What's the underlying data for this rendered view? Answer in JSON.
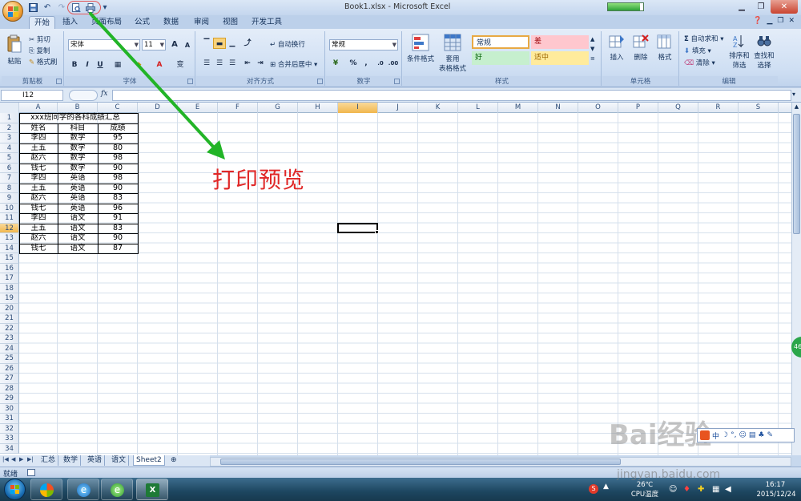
{
  "window": {
    "title": "Book1.xlsx - Microsoft Excel",
    "progress_fraction": 0.9
  },
  "qat": {
    "undo": "↶",
    "redo": "↷",
    "more": "▾"
  },
  "tabs": [
    {
      "label": "开始",
      "active": true
    },
    {
      "label": "插入"
    },
    {
      "label": "页面布局"
    },
    {
      "label": "公式"
    },
    {
      "label": "数据"
    },
    {
      "label": "审阅"
    },
    {
      "label": "视图"
    },
    {
      "label": "开发工具"
    }
  ],
  "ribbon": {
    "clipboard": {
      "paste": "粘贴",
      "cut": "剪切",
      "copy": "复制",
      "format_painter": "格式刷",
      "label": "剪贴板"
    },
    "font": {
      "name": "宋体",
      "size": "11",
      "bold": "B",
      "italic": "I",
      "underline": "U",
      "label": "字体",
      "grow": "A",
      "shrink": "A",
      "phonetic": "变"
    },
    "alignment": {
      "wrap": "自动换行",
      "merge": "合并后居中",
      "label": "对齐方式"
    },
    "number": {
      "format": "常规",
      "percent": "%",
      "comma": ",",
      "label": "数字"
    },
    "styles": {
      "conditional": "条件格式",
      "table_format": "套用",
      "table_format2": "表格格式",
      "normal": "常规",
      "bad": "差",
      "good": "好",
      "neutral": "适中",
      "label": "样式",
      "color_normal": "#ffffff",
      "color_bad": "#ffc7ce",
      "color_good": "#c6efce",
      "color_neutral": "#ffeb9c"
    },
    "cells": {
      "insert": "插入",
      "delete": "删除",
      "format": "格式",
      "label": "单元格"
    },
    "editing": {
      "autosum": "自动求和",
      "fill": "填充",
      "clear": "清除",
      "sort": "排序和",
      "sort2": "筛选",
      "find": "查找和",
      "find2": "选择",
      "label": "编辑"
    }
  },
  "formula_bar": {
    "name_box": "I12",
    "fx": "fx",
    "content": ""
  },
  "columns": [
    "A",
    "B",
    "C",
    "D",
    "E",
    "F",
    "G",
    "H",
    "I",
    "J",
    "K",
    "L",
    "M",
    "N",
    "O",
    "P",
    "Q",
    "R",
    "S"
  ],
  "selected_column": "I",
  "rows": [
    "1",
    "2",
    "3",
    "4",
    "5",
    "6",
    "7",
    "8",
    "9",
    "10",
    "11",
    "12",
    "13",
    "14",
    "15",
    "16",
    "17",
    "18",
    "19",
    "20",
    "21",
    "22",
    "23",
    "24",
    "25",
    "26",
    "27",
    "28",
    "29",
    "30",
    "31",
    "32",
    "33",
    "34"
  ],
  "selected_row": "12",
  "sheet": {
    "title": "xxx班同学的各科成绩汇总",
    "headers": [
      "姓名",
      "科目",
      "成绩"
    ],
    "data": [
      [
        "李四",
        "数学",
        "95"
      ],
      [
        "王五",
        "数学",
        "80"
      ],
      [
        "赵六",
        "数学",
        "98"
      ],
      [
        "钱七",
        "数学",
        "90"
      ],
      [
        "李四",
        "英语",
        "98"
      ],
      [
        "王五",
        "英语",
        "90"
      ],
      [
        "赵六",
        "英语",
        "83"
      ],
      [
        "钱七",
        "英语",
        "96"
      ],
      [
        "李四",
        "语文",
        "91"
      ],
      [
        "王五",
        "语文",
        "83"
      ],
      [
        "赵六",
        "语文",
        "90"
      ],
      [
        "钱七",
        "语文",
        "87"
      ]
    ]
  },
  "sheet_tabs": [
    {
      "label": "汇总"
    },
    {
      "label": "数学"
    },
    {
      "label": "英语"
    },
    {
      "label": "语文"
    },
    {
      "label": "Sheet2",
      "active": true
    }
  ],
  "status": {
    "text": "就绪"
  },
  "taskbar": {
    "temp": "26℃",
    "cpu": "CPU温度",
    "time": "16:17",
    "date": "2015/12/24"
  },
  "annotation": {
    "label": "打印预览"
  },
  "ime": {
    "lang": "中"
  },
  "side_badge": "46",
  "watermark": {
    "brand": "Bai经验",
    "url": "jingyan.baidu.com"
  }
}
